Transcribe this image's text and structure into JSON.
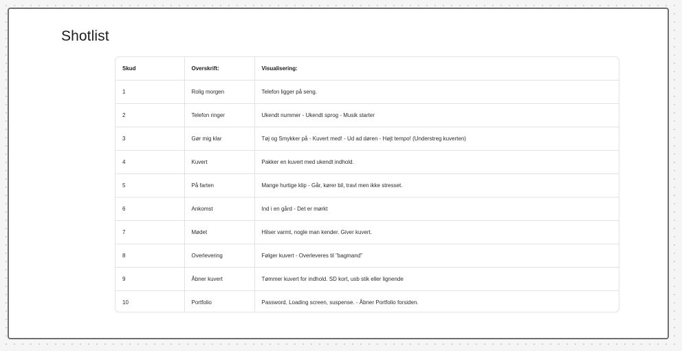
{
  "page": {
    "title": "Shotlist"
  },
  "table": {
    "headers": [
      "Skud",
      "Overskrift:",
      "Visualisering:"
    ],
    "rows": [
      {
        "skud": "1",
        "overskrift": "Rolig morgen",
        "visualisering": "Telefon ligger på seng."
      },
      {
        "skud": "2",
        "overskrift": "Telefon ringer",
        "visualisering": "Ukendt nummer - Ukendt sprog - Musik starter"
      },
      {
        "skud": "3",
        "overskrift": "Gør mig klar",
        "visualisering": "Tøj og Smykker på - Kuvert med! - Ud ad døren - Højt tempo! (Understreg kuverten)"
      },
      {
        "skud": "4",
        "overskrift": "Kuvert",
        "visualisering": "Pakker en kuvert med ukendt indhold."
      },
      {
        "skud": "5",
        "overskrift": "På farten",
        "visualisering": "Mange hurtige klip - Går, kører bil, travl men ikke stresset."
      },
      {
        "skud": "6",
        "overskrift": "Ankomst",
        "visualisering": "Ind i en gård - Det er mørkt"
      },
      {
        "skud": "7",
        "overskrift": "Mødet",
        "visualisering": "Hilser varmt, nogle man kender. Giver kuvert."
      },
      {
        "skud": "8",
        "overskrift": "Overlevering",
        "visualisering": "Følger kuvert - Overleveres til \"bagmand\""
      },
      {
        "skud": "9",
        "overskrift": "Åbner kuvert",
        "visualisering": "Tømmer kuvert for indhold. SD kort, usb stik eller lignende"
      },
      {
        "skud": "10",
        "overskrift": "Portfolio",
        "visualisering": "Password, Loading screen, suspense. - Åbner Portfolio forsiden."
      }
    ]
  }
}
